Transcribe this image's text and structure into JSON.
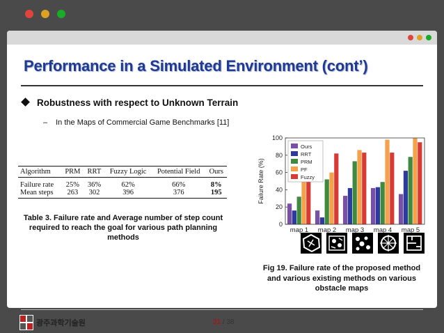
{
  "window": {
    "dot_colors": [
      "#e0443e",
      "#dea123",
      "#1aab29"
    ]
  },
  "slide_bar": {
    "dot_colors": [
      "#e0443e",
      "#dea123",
      "#1aab29"
    ]
  },
  "title": "Performance in a Simulated Environment (cont’)",
  "bullet": "Robustness with respect to Unknown Terrain",
  "sub_bullet": {
    "dash": "–",
    "text": "In the Maps of Commercial Game Benchmarks [11]"
  },
  "table": {
    "headers": [
      "Algorithm",
      "PRM",
      "RRT",
      "Fuzzy Logic",
      "Potential Field",
      "Ours"
    ],
    "rows": [
      [
        "Failure rate",
        "25%",
        "36%",
        "62%",
        "66%",
        "8%"
      ],
      [
        "Mean steps",
        "263",
        "302",
        "396",
        "376",
        "195"
      ]
    ]
  },
  "table_caption": "Table 3. Failure rate and Average number of step count required to reach the goal for various path planning methods",
  "chart_data": {
    "type": "bar",
    "categories": [
      "map 1",
      "map 2",
      "map 3",
      "map 4",
      "map 5"
    ],
    "series": [
      {
        "name": "Ours",
        "color": "#7b4fa8",
        "values": [
          24,
          16,
          33,
          42,
          35
        ]
      },
      {
        "name": "RRT",
        "color": "#2e3b9a",
        "values": [
          16,
          8,
          42,
          43,
          62
        ]
      },
      {
        "name": "PRM",
        "color": "#3e8a3e",
        "values": [
          32,
          52,
          73,
          49,
          78
        ]
      },
      {
        "name": "PF",
        "color": "#f5a04a",
        "values": [
          52,
          60,
          86,
          98,
          100
        ]
      },
      {
        "name": "Fuzzy",
        "color": "#d83a35",
        "values": [
          72,
          82,
          83,
          83,
          95
        ]
      }
    ],
    "ylabel": "Failure Rate (%)",
    "xlabel": "",
    "ylim": [
      0,
      100
    ],
    "yticks": [
      "0",
      "20",
      "40",
      "60",
      "80",
      "100"
    ],
    "legend": "top-left",
    "grid": false
  },
  "chart_caption": "Fig 19. Failure rate of the proposed method and various existing methods on various obstacle maps",
  "footer": {
    "logo_text": "광주과학기술원",
    "page_current": "31",
    "page_sep": " / ",
    "page_total": "38"
  }
}
